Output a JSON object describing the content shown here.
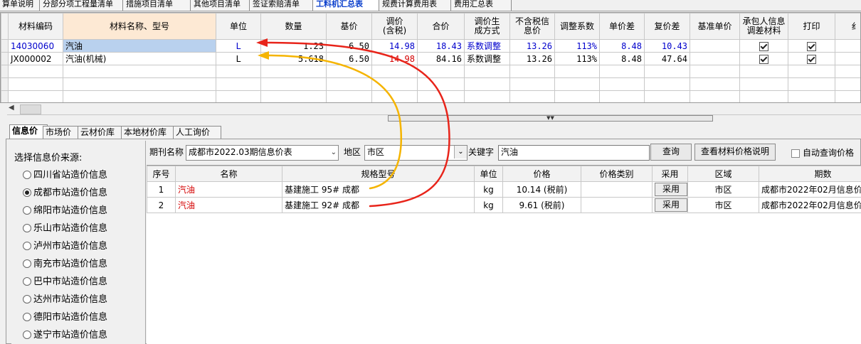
{
  "top_tabs": [
    "算单说明",
    "分部分项工程量清单",
    "措施项目清单",
    "其他项目清单",
    "签证索赔清单",
    "工料机汇总表",
    "规费计算费用表",
    "费用汇总表"
  ],
  "grid": {
    "headers": [
      "材料编码",
      "材料名称、型号",
      "单位",
      "数量",
      "基价",
      "调价\n(含税)",
      "合价",
      "调价生\n成方式",
      "不含税信\n息价",
      "调整系数",
      "单价差",
      "复价差",
      "基准单价",
      "承包人信息\n调差材料",
      "打印",
      "纟"
    ],
    "rows": [
      {
        "code": "14030060",
        "name": "汽油",
        "unit": "L",
        "qty": "1.23",
        "base": "6.50",
        "adj": "14.98",
        "total": "18.43",
        "method": "系数调整",
        "info": "13.26",
        "coef": "113%",
        "diff": "8.48",
        "rediff": "10.43",
        "bench": "",
        "contractor": true,
        "print": true
      },
      {
        "code": "JX000002",
        "name": "汽油(机械)",
        "unit": "L",
        "qty": "5.618",
        "base": "6.50",
        "adj": "14.98",
        "total": "84.16",
        "method": "系数调整",
        "info": "13.26",
        "coef": "113%",
        "diff": "8.48",
        "rediff": "47.64",
        "bench": "",
        "contractor": true,
        "print": true
      }
    ]
  },
  "lower_tabs": [
    "信息价",
    "市场价",
    "云材价库",
    "本地材价库",
    "人工询价"
  ],
  "source_panel": {
    "title": "选择信息价来源:",
    "selected_index": 1,
    "items": [
      "四川省站造价信息",
      "成都市站造价信息",
      "绵阳市站造价信息",
      "乐山市站造价信息",
      "泸州市站造价信息",
      "南充市站造价信息",
      "巴中市站造价信息",
      "达州市站造价信息",
      "德阳市站造价信息",
      "遂宁市站造价信息"
    ]
  },
  "query": {
    "period_label": "期刊名称",
    "period_value": "成都市2022.03期信息价表",
    "region_label": "地区",
    "region_value": "市区",
    "keyword_label": "关键字",
    "keyword_value": "汽油",
    "search_button": "查询",
    "explain_button": "查看材料价格说明",
    "auto_query_label": "自动查询价格",
    "auto_query_checked": false
  },
  "results": {
    "headers": [
      "序号",
      "名称",
      "规格型号",
      "单位",
      "价格",
      "价格类别",
      "采用",
      "区域",
      "期数"
    ],
    "rows": [
      {
        "no": "1",
        "name": "汽油",
        "spec": "基建施工 95# 成都",
        "unit": "kg",
        "price": "10.14 (税前)",
        "category": "",
        "adopt": "采用",
        "region": "市区",
        "period": "成都市2022年02月信息价"
      },
      {
        "no": "2",
        "name": "汽油",
        "spec": "基建施工 92# 成都",
        "unit": "kg",
        "price": "9.61 (税前)",
        "category": "",
        "adopt": "采用",
        "region": "市区",
        "period": "成都市2022年02月信息价"
      }
    ]
  },
  "colors": {
    "annot_red": "#e8241a",
    "annot_yellow": "#f5b400",
    "link_blue": "#0000cc",
    "header_highlight": "#fde9d4"
  }
}
